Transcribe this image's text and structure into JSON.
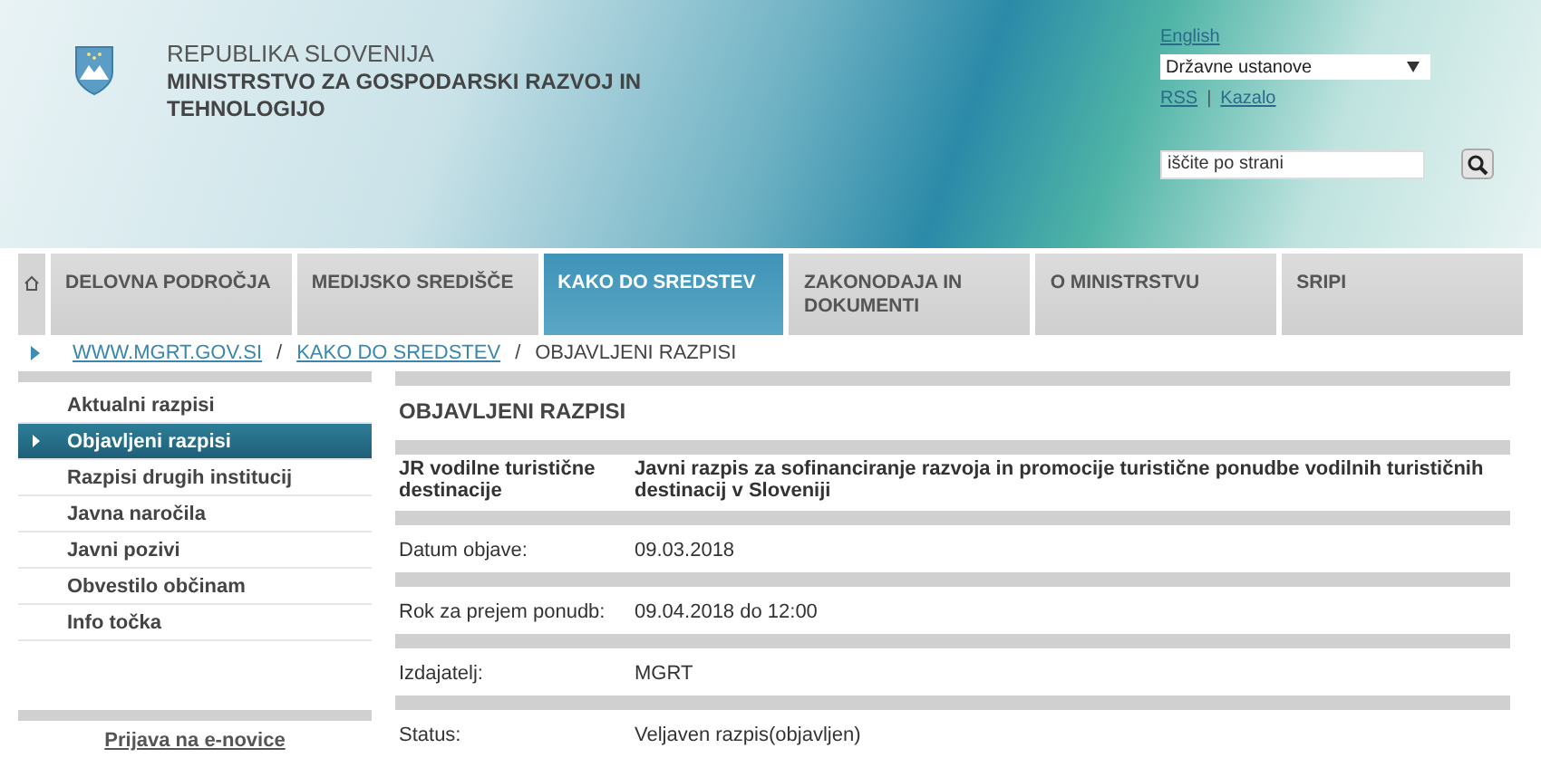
{
  "header": {
    "country": "REPUBLIKA SLOVENIJA",
    "ministry": "MINISTRSTVO ZA GOSPODARSKI RAZVOJ IN TEHNOLOGIJO",
    "language_link": "English",
    "institutions_select": "Državne ustanove",
    "links": [
      "RSS",
      "Kazalo"
    ],
    "links_separator": "|",
    "search": {
      "placeholder": "iščite po strani"
    }
  },
  "nav": [
    {
      "label": "DELOVNA PODROČJA",
      "selected": false
    },
    {
      "label": "MEDIJSKO SREDIŠČE",
      "selected": false
    },
    {
      "label": "KAKO DO SREDSTEV",
      "selected": true
    },
    {
      "label": "ZAKONODAJA IN DOKUMENTI",
      "selected": false
    },
    {
      "label": "O MINISTRSTVU",
      "selected": false
    },
    {
      "label": "SRIPI",
      "selected": false
    }
  ],
  "breadcrumb_separator": "/",
  "breadcrumb": [
    {
      "label": "WWW.MGRT.GOV.SI",
      "link": true
    },
    {
      "label": "KAKO DO SREDSTEV",
      "link": true
    },
    {
      "label": "OBJAVLJENI RAZPISI",
      "link": false
    }
  ],
  "sidebar": {
    "items": [
      {
        "label": "Aktualni razpisi",
        "selected": false
      },
      {
        "label": "Objavljeni razpisi",
        "selected": true
      },
      {
        "label": "Razpisi drugih institucij",
        "selected": false
      },
      {
        "label": "Javna naročila",
        "selected": false
      },
      {
        "label": "Javni pozivi",
        "selected": false
      },
      {
        "label": "Obvestilo občinam",
        "selected": false
      },
      {
        "label": "Info točka",
        "selected": false
      }
    ],
    "newsletter_link": "Prijava na e-novice"
  },
  "main": {
    "title": "OBJAVLJENI RAZPISI",
    "rows": [
      {
        "label": "JR vodilne turistične destinacije",
        "value": "Javni razpis za sofinanciranje razvoja in promocije turistične ponudbe vodilnih turističnih destinacij v Sloveniji",
        "kind": "heading"
      },
      {
        "label": "Datum objave:",
        "value": "09.03.2018",
        "kind": "field"
      },
      {
        "label": "Rok za prejem ponudb:",
        "value": "09.04.2018 do 12:00",
        "kind": "field"
      },
      {
        "label": "Izdajatelj:",
        "value": "MGRT",
        "kind": "field"
      },
      {
        "label": "Status:",
        "value": "Veljaven razpis(objavljen)",
        "kind": "field"
      }
    ]
  }
}
